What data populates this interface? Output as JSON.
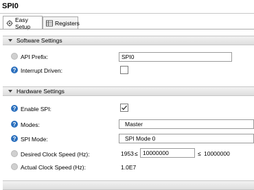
{
  "window": {
    "title": "SPI0"
  },
  "tabs": [
    {
      "label": "Easy Setup",
      "icon": "gear-icon",
      "active": true
    },
    {
      "label": "Registers",
      "icon": "table-icon",
      "active": false
    }
  ],
  "software_settings": {
    "header": "Software Settings",
    "api_prefix": {
      "label": "API Prefix:",
      "value": "SPI0"
    },
    "interrupt_driven": {
      "label": "Interrupt Driven:",
      "checked": false
    }
  },
  "hardware_settings": {
    "header": "Hardware Settings",
    "enable_spi": {
      "label": "Enable SPI:",
      "checked": true
    },
    "modes": {
      "label": "Modes:",
      "value": "Master"
    },
    "spi_mode": {
      "label": "SPI Mode:",
      "value": "SPI Mode 0"
    },
    "desired_clock": {
      "label": "Desired Clock Speed (Hz):",
      "min_text": "1953",
      "le1": "≤",
      "value": "10000000",
      "le2": "≤",
      "max_text": "10000000"
    },
    "actual_clock": {
      "label": "Actual Clock Speed (Hz):",
      "value": "1.0E7"
    }
  },
  "colors": {
    "help_icon": "#2a6fbd",
    "header_bg": "#e6e6e6"
  }
}
